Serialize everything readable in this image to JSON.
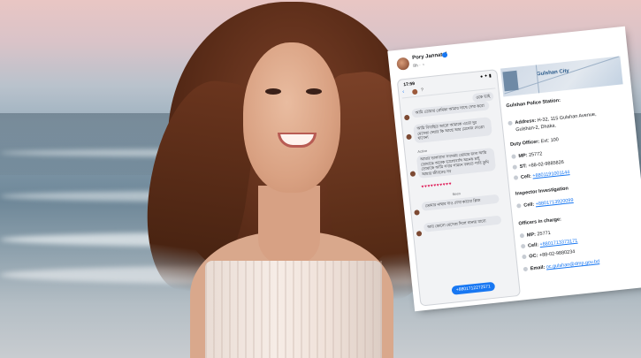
{
  "post": {
    "author": "Pory Jannatul",
    "meta": "8h · ◔"
  },
  "chat": {
    "time": "17:59",
    "signal": "● ✦ ▮",
    "back": "‹",
    "contact_hint": "?",
    "bubble_1": "ওকে ভাই",
    "bubble_2": "আমি তোমার প্রেমিকা আমার সাথে দেখা করো",
    "bubble_3": "আমি বিবাহিত আরো আমাকে এতো দুর মেসেজ দেয়ার কি আছে আর মেসেজ দেওয়া যাবেনা",
    "label_active": "Active",
    "bubble_4": "আমার ভালবাসা সবসময় তোমার জন্য আমি তোমাকে অনেক ভালোবাসি অনেক চাই তোমাকে আমি সবার সামনে বলতে পারি তুমি আমার জীবনের সব",
    "hearts": "♥♥♥♥♥♥♥♥♥♥",
    "label_seen": "Seen",
    "bubble_5": "তোমার নাম্বার দাও দেখা করবো প্লিজ",
    "bubble_6": "আর কোনো মেসেজ দিলে থানায় যাবো",
    "phone_pill": "+8801712272571"
  },
  "map": {
    "city": "Gulshan City"
  },
  "police": {
    "title": "Gulshan Police Station:",
    "address_label": "Address:",
    "address_value": "H-32, 115 Gulshan Avenue,",
    "address_value_2": "Gulshan-2, Dhaka.",
    "duty_label": "Duty Officer:",
    "duty_value": "Ext: 100",
    "mp_label": "MP:",
    "mp_value": "25772",
    "st_label": "ST:",
    "st_value": "+88-02-9885826",
    "cell_label": "Cell:",
    "cell_value": "+8801191001144",
    "inspector_title": "Inspector Investigation",
    "inspector_cell_label": "Cell:",
    "inspector_cell_value": "+8801713920099",
    "incharge_title": "Officers in charge:",
    "incharge_mp_label": "MP:",
    "incharge_mp_value": "25771",
    "incharge_cell_label": "Cell:",
    "incharge_cell_value": "+8801713373171",
    "incharge_oc_label": "OC:",
    "incharge_oc_value": "+88-02-9880234",
    "email_label": "Email:",
    "email_value": "oc.gulshan@dmp.gov.bd"
  }
}
